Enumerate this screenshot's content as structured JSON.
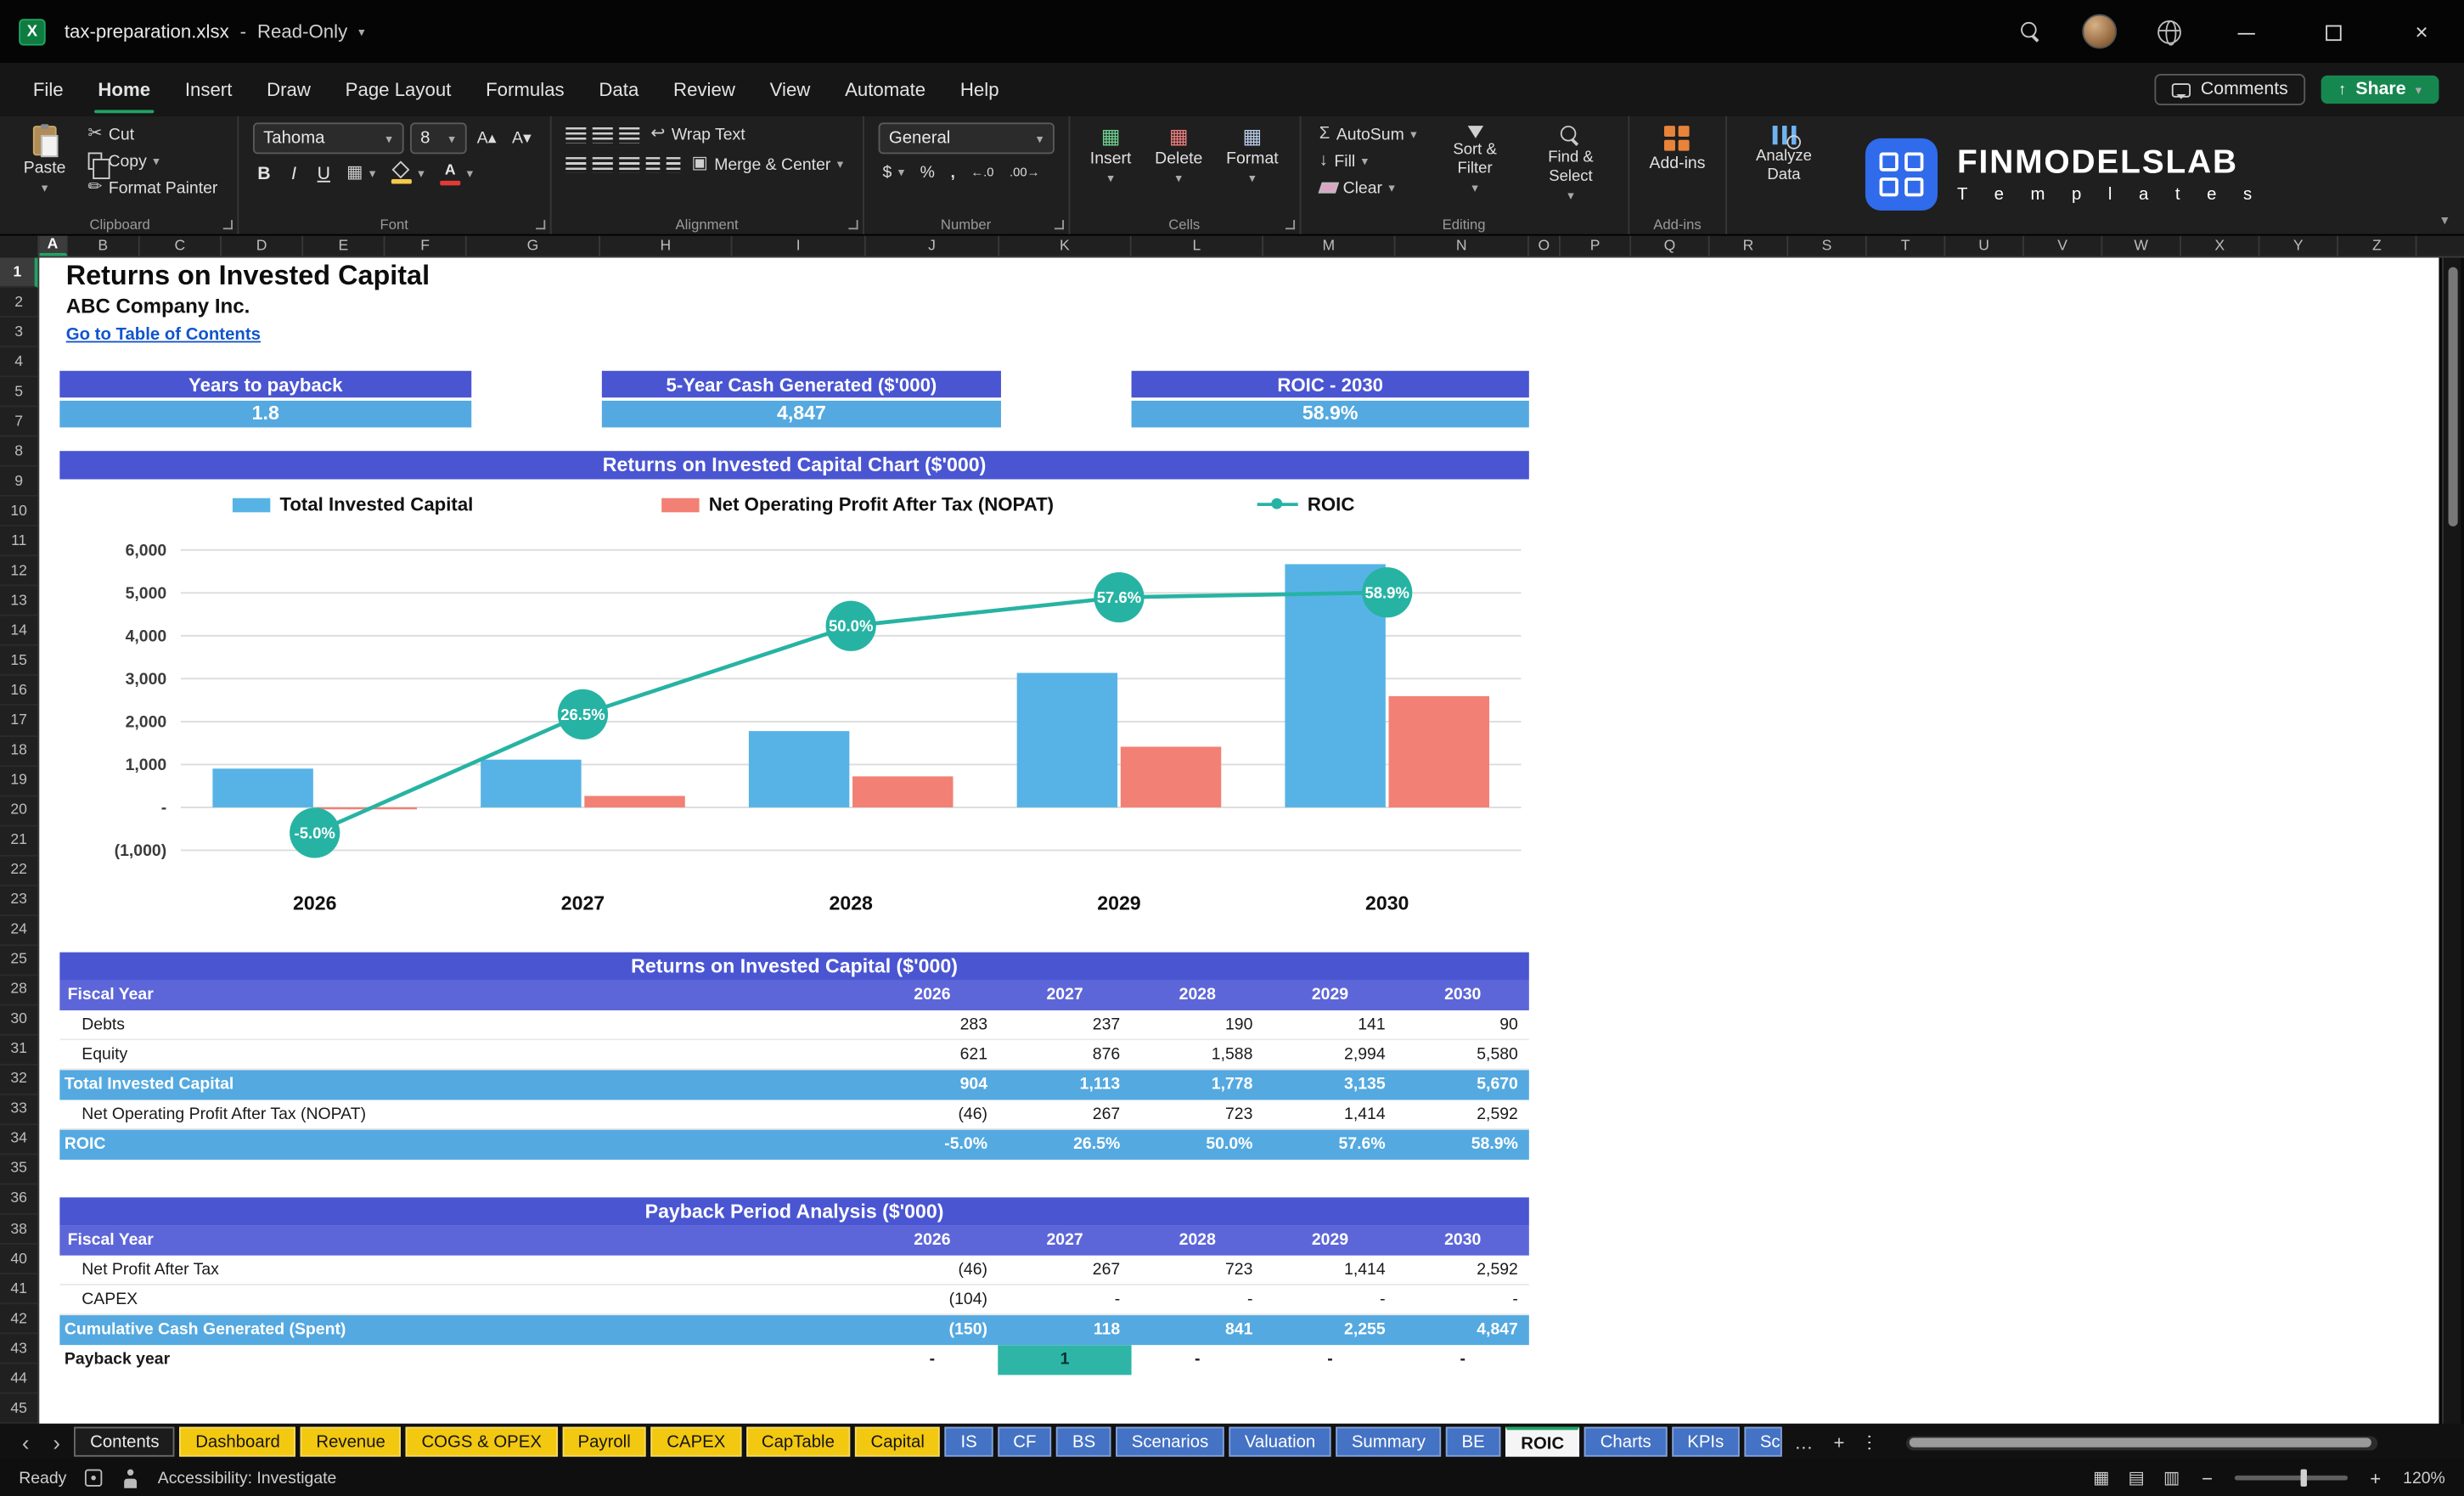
{
  "palette": {
    "indigo": "#4a55d2",
    "indigo_light": "#5d66d8",
    "sky": "#54a9e0",
    "salmon": "#f28074",
    "teal": "#27b3a3",
    "tab_yellow": "#f2c811",
    "tab_blue": "#4472c4",
    "excel_green": "#21a366"
  },
  "titlebar": {
    "icon_glyph": "X",
    "filename": "tax-preparation.xlsx",
    "separator": "-",
    "mode": "Read-Only"
  },
  "menubar": {
    "tabs": [
      "File",
      "Home",
      "Insert",
      "Draw",
      "Page Layout",
      "Formulas",
      "Data",
      "Review",
      "View",
      "Automate",
      "Help"
    ],
    "active_tab": "Home",
    "comments_label": "Comments",
    "share_label": "Share"
  },
  "ribbon": {
    "paste": "Paste",
    "cut": "Cut",
    "copy": "Copy",
    "format_painter": "Format Painter",
    "clipboard_group": "Clipboard",
    "font_name": "Tahoma",
    "font_size": "8",
    "font_group": "Font",
    "wrap_text": "Wrap Text",
    "merge_center": "Merge & Center",
    "alignment_group": "Alignment",
    "number_format": "General",
    "number_group": "Number",
    "insert": "Insert",
    "delete": "Delete",
    "format": "Format",
    "cells_group": "Cells",
    "autosum": "AutoSum",
    "fill": "Fill",
    "clear": "Clear",
    "sort_filter": "Sort & Filter",
    "find_select": "Find & Select",
    "editing_group": "Editing",
    "addins": "Add-ins",
    "addins_group": "Add-ins",
    "analyze_data": "Analyze Data"
  },
  "brand": {
    "title": "FINMODELSLAB",
    "subtitle": "T e m p l a t e s"
  },
  "grid": {
    "columns": [
      "A",
      "B",
      "C",
      "D",
      "E",
      "F",
      "G",
      "H",
      "I",
      "J",
      "K",
      "L",
      "M",
      "N",
      "O",
      "P",
      "Q",
      "R",
      "S",
      "T",
      "U",
      "V",
      "W",
      "X",
      "Y",
      "Z"
    ],
    "selected_column": "A",
    "rows": [
      "1",
      "2",
      "3",
      "4",
      "5",
      "7",
      "8",
      "9",
      "10",
      "11",
      "12",
      "13",
      "14",
      "15",
      "16",
      "17",
      "18",
      "19",
      "20",
      "21",
      "22",
      "23",
      "24",
      "25",
      "28",
      "30",
      "31",
      "32",
      "33",
      "34",
      "35",
      "36",
      "38",
      "40",
      "41",
      "42",
      "43",
      "44",
      "45"
    ],
    "selected_row": "1"
  },
  "sheet": {
    "title": "Returns on Invested Capital",
    "subtitle": "ABC Company Inc.",
    "link": "Go to Table of Contents",
    "kpis": [
      {
        "label": "Years to payback",
        "value": "1.8"
      },
      {
        "label": "5-Year Cash Generated ($'000)",
        "value": "4,847"
      },
      {
        "label": "ROIC - 2030",
        "value": "58.9%"
      }
    ],
    "table1": {
      "title": "Returns on Invested Capital ($'000)",
      "header_row": {
        "label": "Fiscal Year",
        "years": [
          "2026",
          "2027",
          "2028",
          "2029",
          "2030"
        ]
      },
      "rows": [
        {
          "label": "Debts",
          "values": [
            "283",
            "237",
            "190",
            "141",
            "90"
          ],
          "style": "plain"
        },
        {
          "label": "Equity",
          "values": [
            "621",
            "876",
            "1,588",
            "2,994",
            "5,580"
          ],
          "style": "plain"
        },
        {
          "label": "Total Invested Capital",
          "values": [
            "904",
            "1,113",
            "1,778",
            "3,135",
            "5,670"
          ],
          "style": "highlight"
        },
        {
          "label": "Net Operating Profit After Tax (NOPAT)",
          "values": [
            "(46)",
            "267",
            "723",
            "1,414",
            "2,592"
          ],
          "style": "plain"
        },
        {
          "label": "ROIC",
          "values": [
            "-5.0%",
            "26.5%",
            "50.0%",
            "57.6%",
            "58.9%"
          ],
          "style": "highlight"
        }
      ]
    },
    "table2": {
      "title": "Payback Period Analysis ($'000)",
      "header_row": {
        "label": "Fiscal Year",
        "years": [
          "2026",
          "2027",
          "2028",
          "2029",
          "2030"
        ]
      },
      "rows": [
        {
          "label": "Net Profit After Tax",
          "values": [
            "(46)",
            "267",
            "723",
            "1,414",
            "2,592"
          ],
          "style": "plain"
        },
        {
          "label": "CAPEX",
          "values": [
            "(104)",
            "-",
            "-",
            "-",
            "-"
          ],
          "style": "plain"
        },
        {
          "label": "Cumulative Cash Generated (Spent)",
          "values": [
            "(150)",
            "118",
            "841",
            "2,255",
            "4,847"
          ],
          "style": "highlight"
        },
        {
          "label": "Payback year",
          "values": [
            "-",
            "1",
            "-",
            "-",
            "-"
          ],
          "style": "payback",
          "highlight_index": 1
        }
      ]
    }
  },
  "chart_data": {
    "type": "bar+line combo",
    "title": "Returns on Invested Capital Chart ($'000)",
    "categories": [
      "2026",
      "2027",
      "2028",
      "2029",
      "2030"
    ],
    "series": [
      {
        "name": "Total Invested Capital",
        "type": "bar",
        "color": "#57b3e6",
        "values": [
          904,
          1113,
          1778,
          3135,
          5670
        ]
      },
      {
        "name": "Net Operating Profit After Tax (NOPAT)",
        "type": "bar",
        "color": "#f28074",
        "values": [
          -46,
          267,
          723,
          1414,
          2592
        ]
      },
      {
        "name": "ROIC",
        "type": "line",
        "color": "#27b3a3",
        "axis": "right",
        "values": [
          -5.0,
          26.5,
          50.0,
          57.6,
          58.9
        ],
        "labels": [
          "-5.0%",
          "26.5%",
          "50.0%",
          "57.6%",
          "58.9%"
        ]
      }
    ],
    "y_ticks": [
      "6,000",
      "5,000",
      "4,000",
      "3,000",
      "2,000",
      "1,000",
      "-",
      "(1,000)"
    ],
    "y_tick_values": [
      6000,
      5000,
      4000,
      3000,
      2000,
      1000,
      0,
      -1000
    ],
    "ylim": [
      -1000,
      6000
    ],
    "grid": true,
    "legend_position": "top"
  },
  "sheet_tabs": {
    "active": "ROIC",
    "tabs": [
      {
        "label": "Contents",
        "color": "dark"
      },
      {
        "label": "Dashboard",
        "color": "yellow"
      },
      {
        "label": "Revenue",
        "color": "yellow"
      },
      {
        "label": "COGS & OPEX",
        "color": "yellow"
      },
      {
        "label": "Payroll",
        "color": "yellow"
      },
      {
        "label": "CAPEX",
        "color": "yellow"
      },
      {
        "label": "CapTable",
        "color": "yellow"
      },
      {
        "label": "Capital",
        "color": "yellow"
      },
      {
        "label": "IS",
        "color": "blue"
      },
      {
        "label": "CF",
        "color": "blue"
      },
      {
        "label": "BS",
        "color": "blue"
      },
      {
        "label": "Scenarios",
        "color": "blue"
      },
      {
        "label": "Valuation",
        "color": "blue"
      },
      {
        "label": "Summary",
        "color": "blue"
      },
      {
        "label": "BE",
        "color": "blue"
      },
      {
        "label": "ROIC",
        "color": "active"
      },
      {
        "label": "Charts",
        "color": "blue"
      },
      {
        "label": "KPIs",
        "color": "blue"
      },
      {
        "label": "Sc",
        "color": "blue",
        "truncated": true
      }
    ]
  },
  "statusbar": {
    "ready": "Ready",
    "accessibility": "Accessibility: Investigate",
    "zoom": "120%"
  }
}
